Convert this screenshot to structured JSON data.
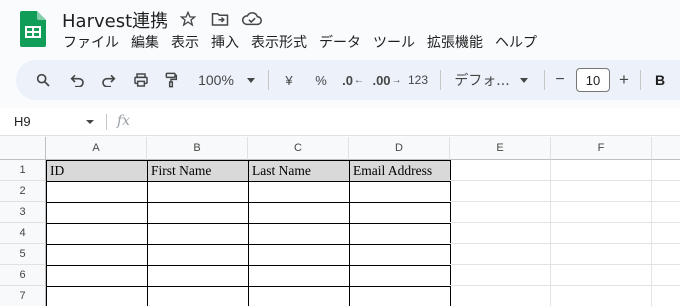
{
  "doc": {
    "title": "Harvest連携"
  },
  "menu": [
    "ファイル",
    "編集",
    "表示",
    "挿入",
    "表示形式",
    "データ",
    "ツール",
    "拡張機能",
    "ヘルプ"
  ],
  "toolbar": {
    "zoom": "100%",
    "currency": "¥",
    "percent": "%",
    "decrease_decimal": ".0",
    "increase_decimal": ".00",
    "number_format": "123",
    "font": "デフォ...",
    "font_size": "10",
    "minus": "−",
    "plus": "+",
    "bold": "B"
  },
  "formula_bar": {
    "cell_ref": "H9",
    "fx": "fx"
  },
  "columns": [
    "A",
    "B",
    "C",
    "D",
    "E",
    "F"
  ],
  "rows": [
    "1",
    "2",
    "3",
    "4",
    "5",
    "6",
    "7"
  ],
  "header_row": [
    "ID",
    "First Name",
    "Last Name",
    "Email Address"
  ],
  "colors": {
    "header_fill": "#d9d9d9",
    "logo_green": "#0f9d58",
    "toolbar_bg": "#edf2fa"
  }
}
